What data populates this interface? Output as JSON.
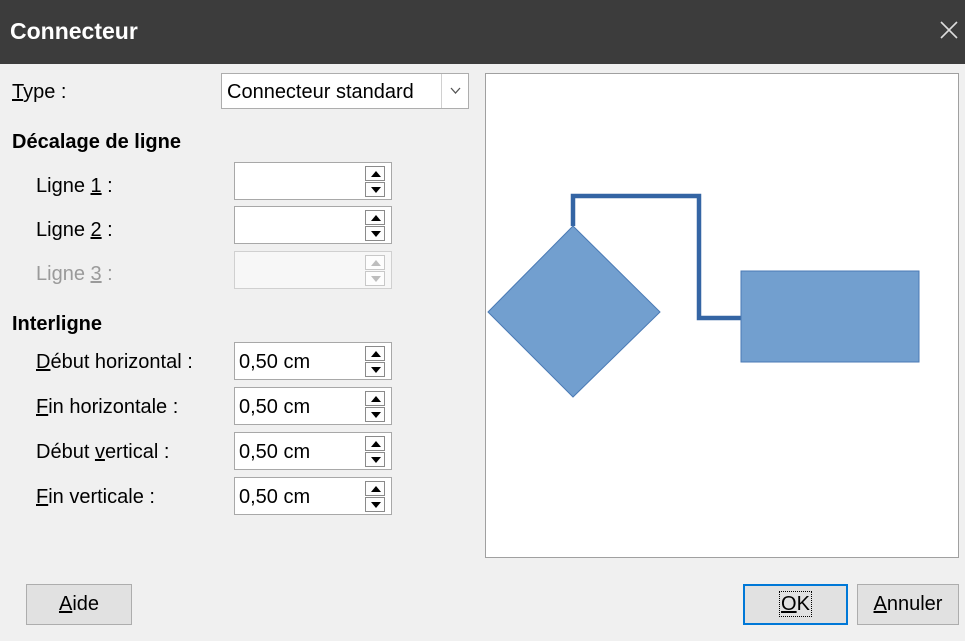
{
  "window": {
    "title": "Connecteur"
  },
  "type": {
    "label_accel": "T",
    "label_rest": "ype :",
    "value": "Connecteur standard"
  },
  "line_skew": {
    "heading": "Décalage de ligne",
    "line1": {
      "pre": "Ligne ",
      "accel": "1",
      "post": " :",
      "value": ""
    },
    "line2": {
      "pre": "Ligne ",
      "accel": "2",
      "post": " :",
      "value": ""
    },
    "line3": {
      "pre": "Ligne ",
      "accel": "3",
      "post": " :",
      "value": ""
    }
  },
  "line_spacing": {
    "heading": "Interligne",
    "begin_h": {
      "pre": "",
      "accel": "D",
      "post": "ébut horizontal :",
      "value": "0,50 cm"
    },
    "end_h": {
      "pre": "",
      "accel": "F",
      "post": "in horizontale :",
      "value": "0,50 cm"
    },
    "begin_v": {
      "pre": "Début ",
      "accel": "v",
      "post": "ertical :",
      "value": "0,50 cm"
    },
    "end_v": {
      "pre": "",
      "accel": "F",
      "post": "in verticale :",
      "value": "0,50 cm"
    }
  },
  "preview": {
    "shape_color": "#729fcf",
    "connector_color": "#3465a4"
  },
  "buttons": {
    "help": {
      "accel": "A",
      "rest": "ide"
    },
    "ok": {
      "accel": "O",
      "rest": "K"
    },
    "cancel": {
      "accel": "A",
      "rest": "nnuler"
    }
  },
  "icons": {
    "close": "close-icon",
    "dropdown": "chevron-down-icon",
    "spin_up": "spin-up-icon",
    "spin_down": "spin-down-icon"
  }
}
